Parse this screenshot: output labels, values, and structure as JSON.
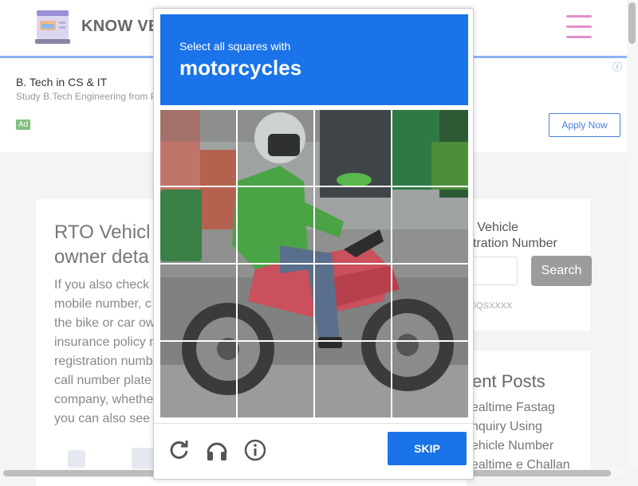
{
  "header": {
    "brand": "KNOW VE",
    "logo_icon": "vehicle-document-logo",
    "menu_icon": "hamburger-icon",
    "accent_color": "#e38fc8"
  },
  "ad": {
    "title": "B. Tech in CS & IT",
    "subtitle": "Study B.Tech Engineering from P",
    "badge": "Ad",
    "apply_label": "Apply Now",
    "info_icon": "info-icon"
  },
  "article": {
    "title": "RTO Vehicl\nowner deta",
    "body_lines": [
      "If you also check",
      "mobile number, c",
      "the bike or car ow",
      "insurance policy n",
      "registration numb",
      "call number plate",
      "company, whethe",
      "you can also see"
    ]
  },
  "search_card": {
    "title": "h Vehicle\nstration Number",
    "button_label": "Search",
    "hint": "0QSXXXX"
  },
  "recent": {
    "title": "ent Posts",
    "items": "ealtime Fastag\nnquiry Using\nehicle Number\nealtime e Challan"
  },
  "captcha": {
    "instruction": "Select all squares with",
    "target": "motorcycles",
    "header_color": "#1a73e8",
    "skip_label": "SKIP",
    "icons": [
      "reload-icon",
      "audio-headphones-icon",
      "info-icon"
    ]
  }
}
